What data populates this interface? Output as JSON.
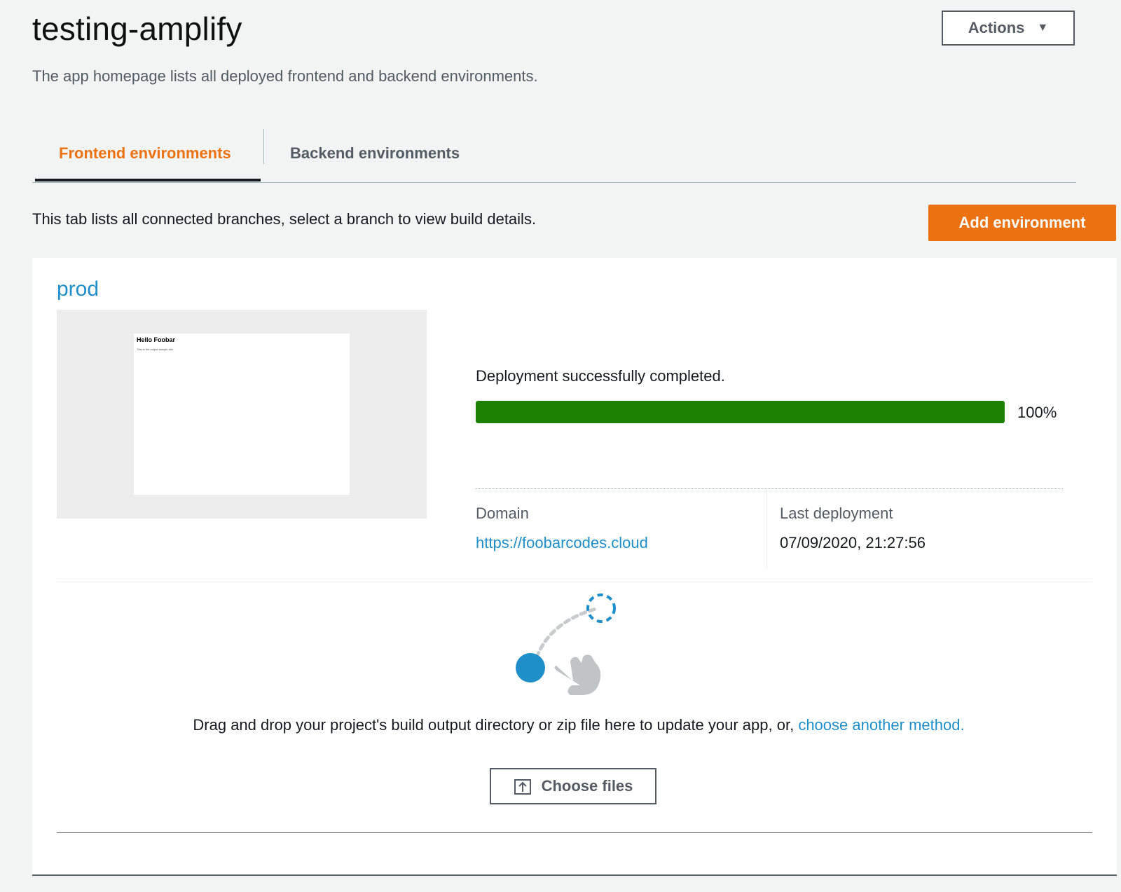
{
  "app": {
    "title": "testing-amplify",
    "subtitle": "The app homepage lists all deployed frontend and backend environments.",
    "actions_label": "Actions"
  },
  "tabs": [
    {
      "label": "Frontend environments",
      "active": true
    },
    {
      "label": "Backend environments",
      "active": false
    }
  ],
  "frontend": {
    "description": "This tab lists all connected branches, select a branch to view build details.",
    "add_environment_label": "Add environment"
  },
  "branch": {
    "name": "prod",
    "preview": {
      "heading": "Hello Foobar",
      "text": "This is the output sample site"
    },
    "status_text": "Deployment successfully completed.",
    "progress_percent": 100,
    "progress_label": "100%",
    "domain_label": "Domain",
    "domain_url": "https://foobarcodes.cloud",
    "last_deployment_label": "Last deployment",
    "last_deployment_value": "07/09/2020, 21:27:56"
  },
  "dropzone": {
    "text": "Drag and drop your project's build output directory or zip file here to update your app, or, ",
    "link_text": "choose another method.",
    "choose_files_label": "Choose files"
  },
  "colors": {
    "accent_orange": "#ec7211",
    "link_blue": "#1e8fc9",
    "success_green": "#1d8102"
  }
}
